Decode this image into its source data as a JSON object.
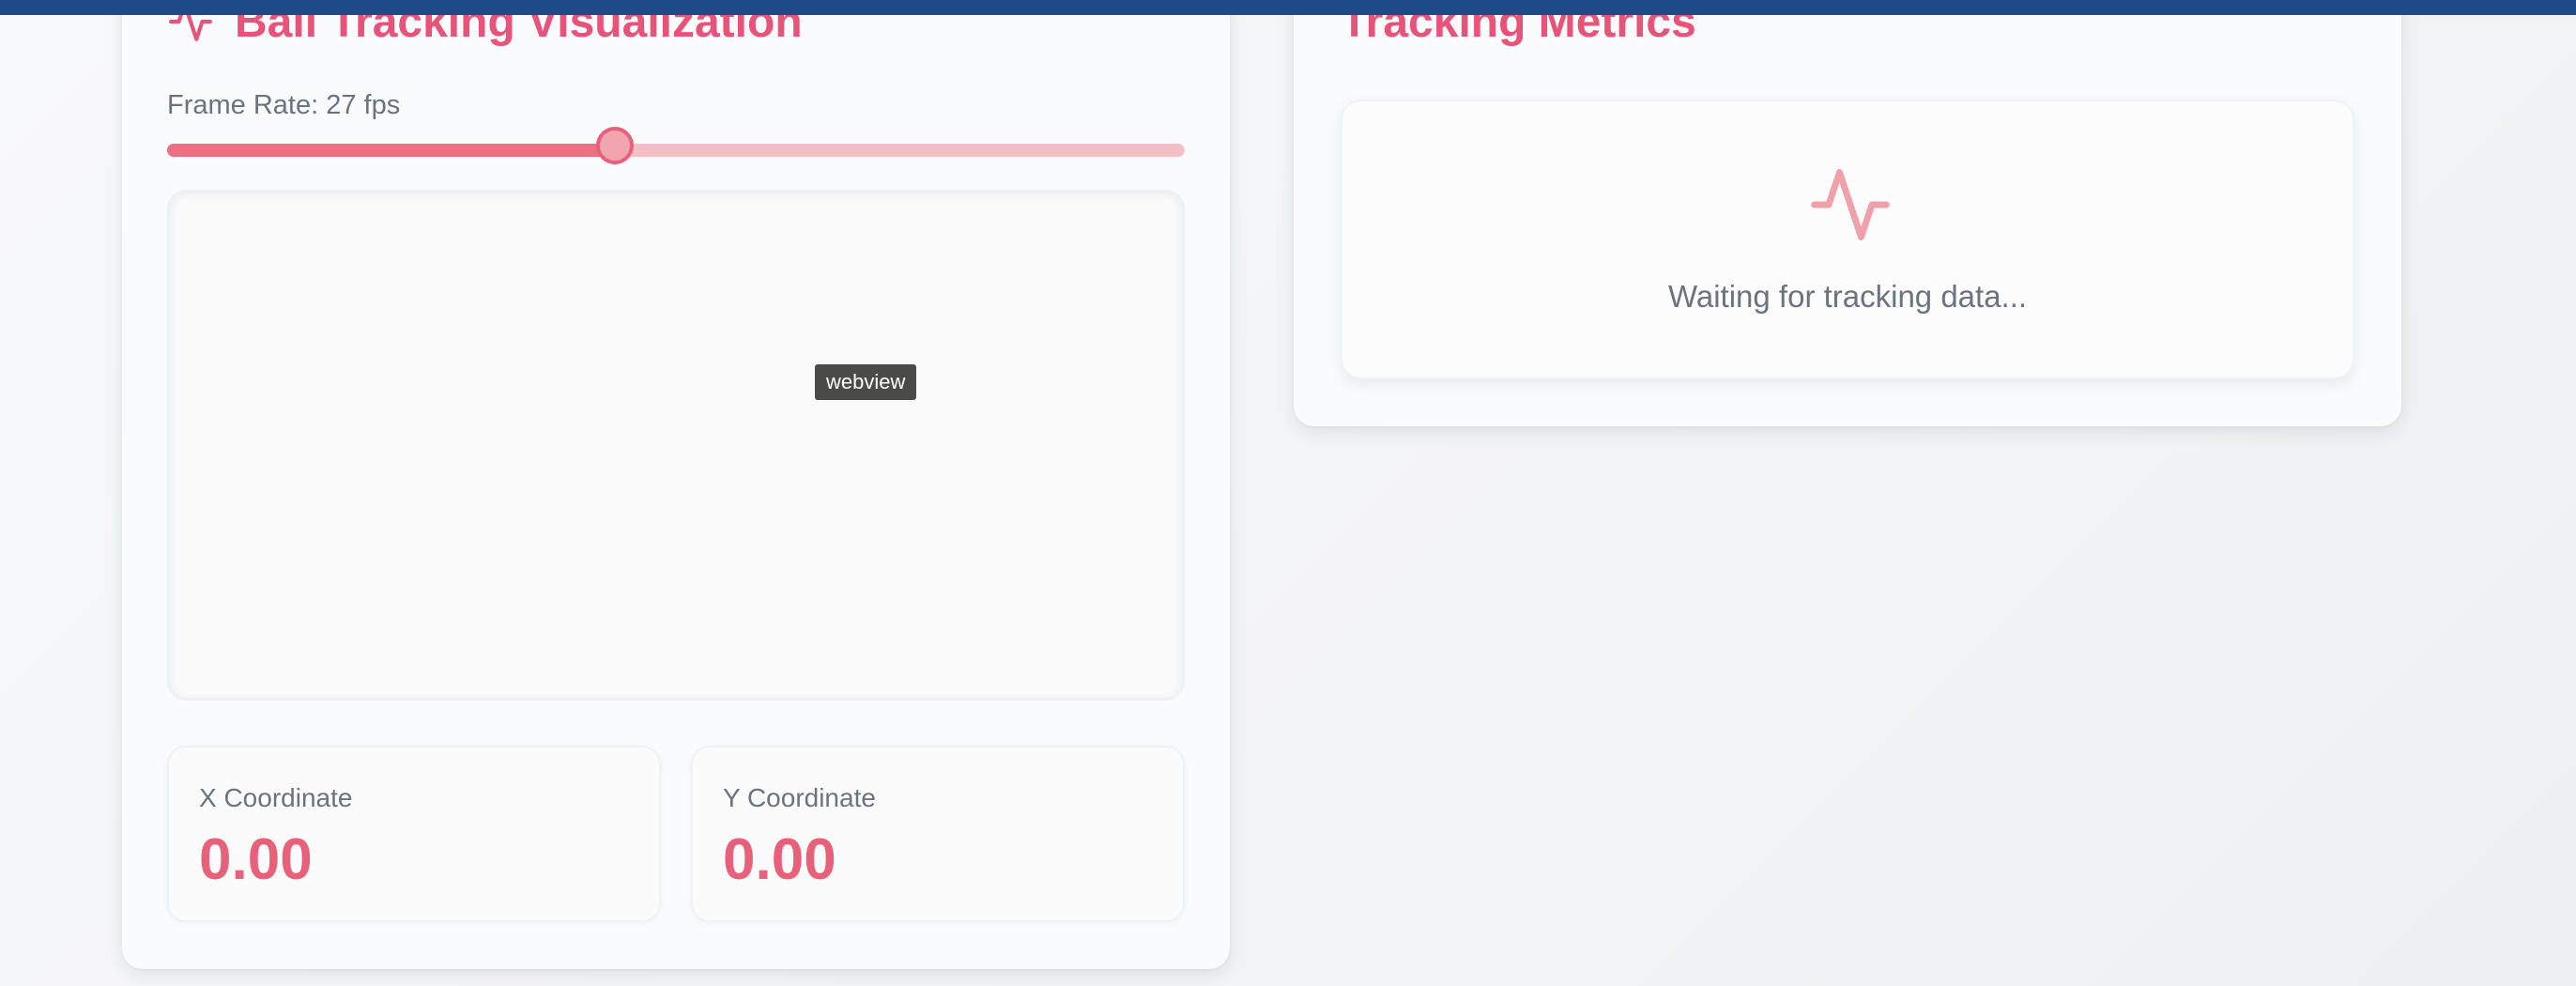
{
  "visualization": {
    "title": "Ball Tracking Visualization",
    "frame_rate_label": "Frame Rate: 27 fps",
    "frame_rate_fraction": 0.44,
    "webview_label": "webview",
    "x_coord": {
      "label": "X Coordinate",
      "value": "0.00"
    },
    "y_coord": {
      "label": "Y Coordinate",
      "value": "0.00"
    }
  },
  "metrics": {
    "title": "Tracking Metrics",
    "status_icon": "activity-pulse-icon",
    "waiting_text": "Waiting for tracking data..."
  },
  "colors": {
    "accent": "#e8537a",
    "slider_fill": "#ec6f82",
    "slider_track": "#f4c0c6",
    "top_strip": "#1e4a8a"
  }
}
